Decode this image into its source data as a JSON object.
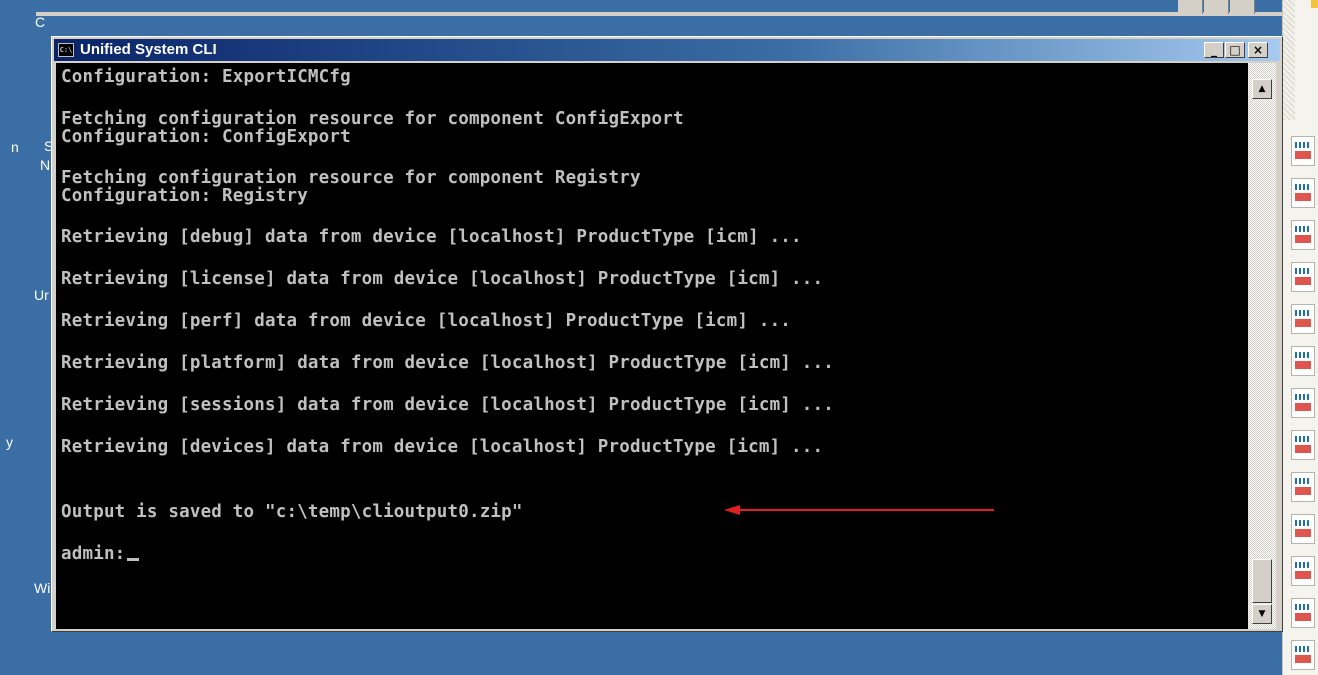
{
  "window": {
    "title": "Unified System CLI",
    "app_icon_label": "C:\\",
    "minimize_label": "_",
    "maximize_label": "□",
    "close_label": "×"
  },
  "console": {
    "lines": [
      "Configuration: ExportICMCfg",
      "Fetching configuration resource for component ConfigExport",
      "Configuration: ConfigExport",
      "Fetching configuration resource for component Registry",
      "Configuration: Registry",
      "Retrieving [debug] data from device [localhost] ProductType [icm] ...",
      "Retrieving [license] data from device [localhost] ProductType [icm] ...",
      "Retrieving [perf] data from device [localhost] ProductType [icm] ...",
      "Retrieving [platform] data from device [localhost] ProductType [icm] ...",
      "Retrieving [sessions] data from device [localhost] ProductType [icm] ...",
      "Retrieving [devices] data from device [localhost] ProductType [icm] ...",
      "Output is saved to \"c:\\temp\\clioutput0.zip\""
    ],
    "prompt": "admin:"
  },
  "desktop": {
    "labels": [
      "C",
      "n",
      "S",
      "N",
      "Ur",
      "y",
      "Wi"
    ]
  },
  "colors": {
    "desktop": "#3a6ea5",
    "titlebar_start": "#0a246a",
    "titlebar_end": "#a6caf0",
    "console_bg": "#000000",
    "console_text": "#c0c0c0",
    "annotation_arrow": "#e0201c"
  },
  "icons": {
    "scroll_up": "▲",
    "scroll_down": "▼",
    "taskbar_item": "cisco-icon"
  }
}
